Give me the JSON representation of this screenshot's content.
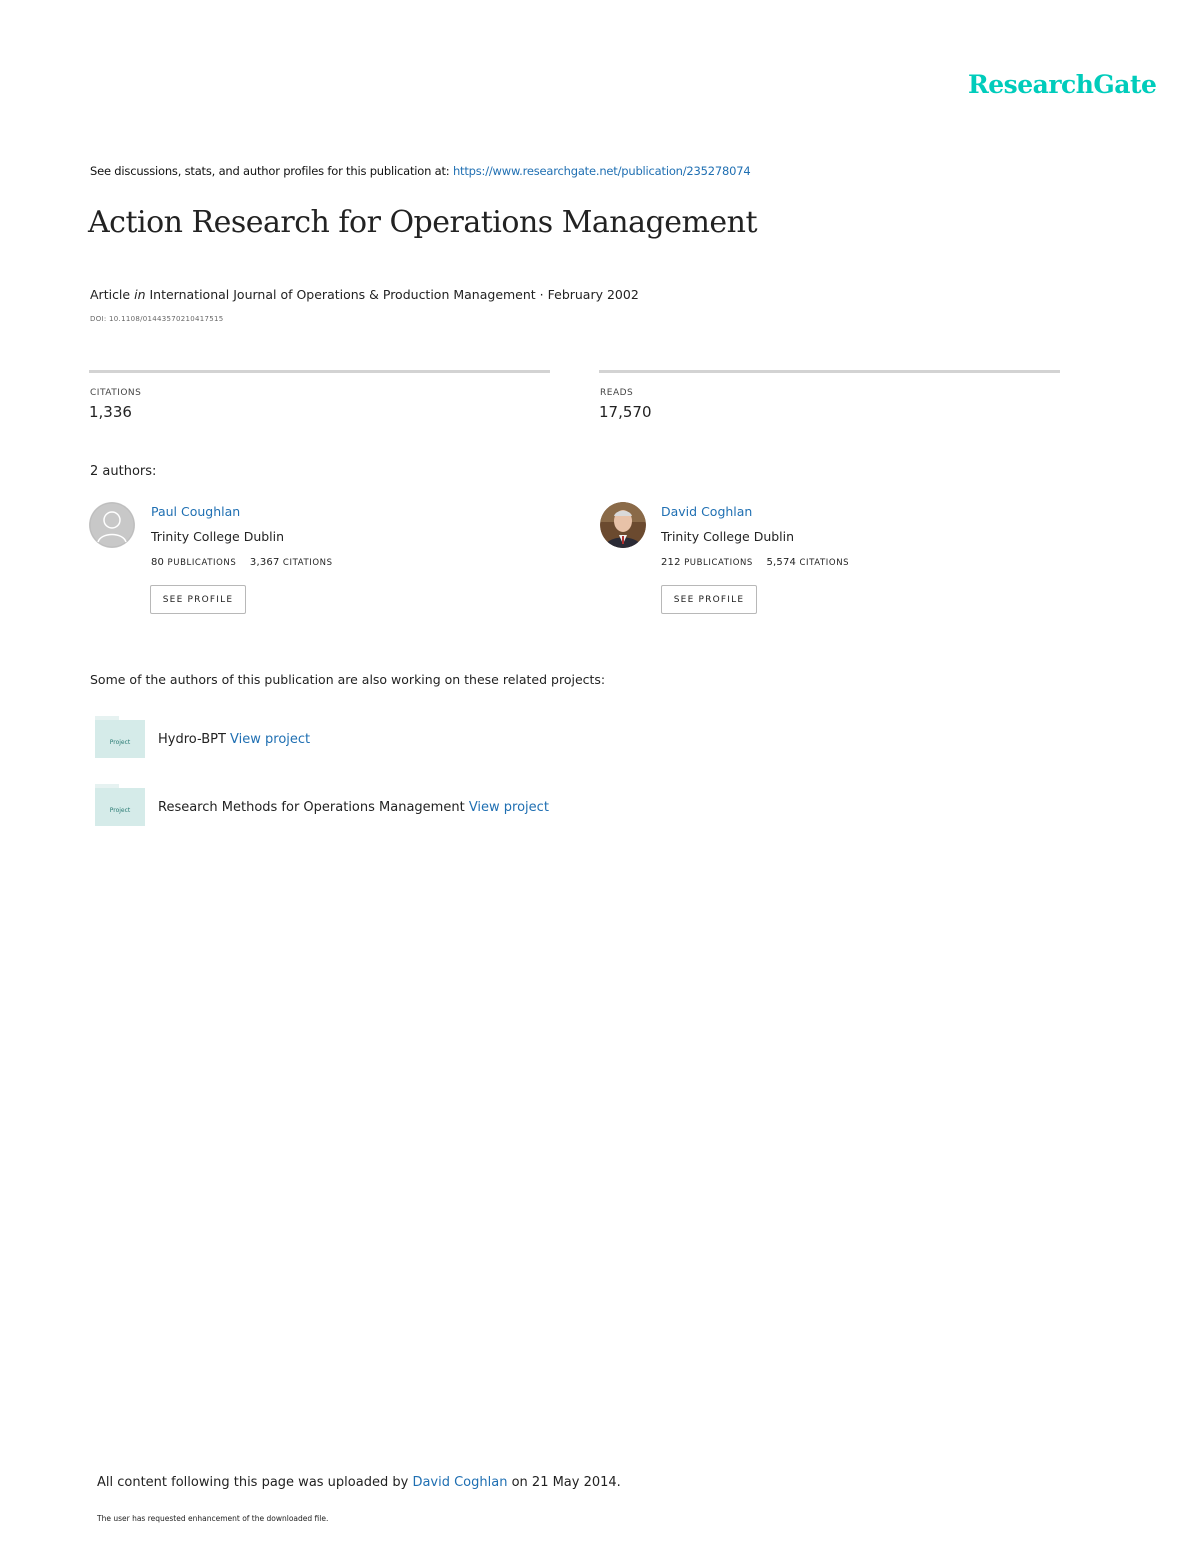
{
  "header": {
    "logo": "ResearchGate",
    "see_prefix": "See discussions, stats, and author profiles for this publication at:",
    "see_url": "https://www.researchgate.net/publication/235278074"
  },
  "publication": {
    "title": "Action Research for Operations Management",
    "type": "Article",
    "in_word": "in",
    "journal": "International Journal of Operations & Production Management · February 2002",
    "doi": "DOI: 10.1108/01443570210417515"
  },
  "stats": {
    "citations_label": "CITATIONS",
    "citations_value": "1,336",
    "reads_label": "READS",
    "reads_value": "17,570"
  },
  "authors_heading": "2 authors:",
  "authors": [
    {
      "name": "Paul Coughlan",
      "institution": "Trinity College Dublin",
      "publications_count": "80",
      "publications_label": "PUBLICATIONS",
      "citations_count": "3,367",
      "citations_label": "CITATIONS",
      "button": "SEE PROFILE"
    },
    {
      "name": "David Coghlan",
      "institution": "Trinity College Dublin",
      "publications_count": "212",
      "publications_label": "PUBLICATIONS",
      "citations_count": "5,574",
      "citations_label": "CITATIONS",
      "button": "SEE PROFILE"
    }
  ],
  "related": {
    "heading": "Some of the authors of this publication are also working on these related projects:",
    "projects": [
      {
        "icon_label": "Project",
        "name": "Hydro-BPT",
        "link": "View project"
      },
      {
        "icon_label": "Project",
        "name": "Research Methods for Operations Management",
        "link": "View project"
      }
    ]
  },
  "footer": {
    "prefix": "All content following this page was uploaded by",
    "uploader": "David Coghlan",
    "suffix": "on 21 May 2014.",
    "note": "The user has requested enhancement of the downloaded file."
  },
  "colors": {
    "brand": "#00ccbb",
    "link": "#1f6fb2",
    "folder": "#d5ebe9"
  }
}
